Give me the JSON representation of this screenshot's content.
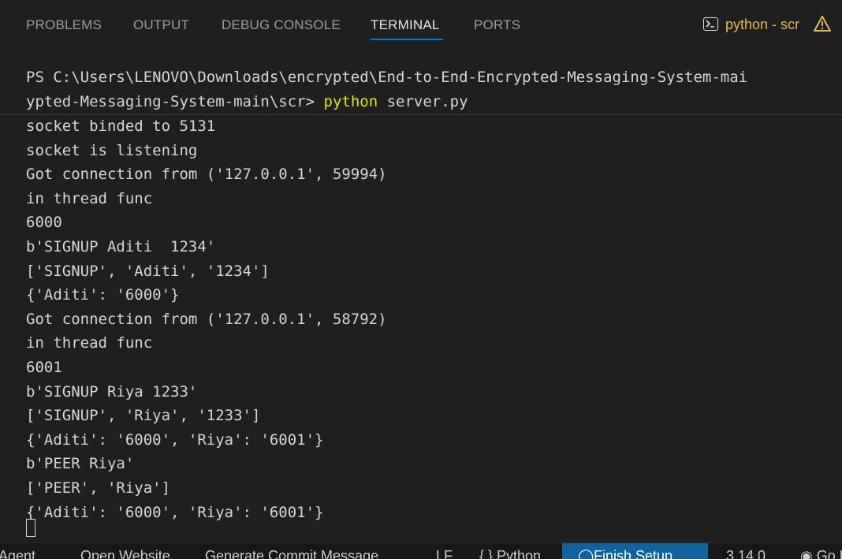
{
  "tabs": [
    {
      "label": "PROBLEMS",
      "active": false
    },
    {
      "label": "OUTPUT",
      "active": false
    },
    {
      "label": "DEBUG CONSOLE",
      "active": false
    },
    {
      "label": "TERMINAL",
      "active": true
    },
    {
      "label": "PORTS",
      "active": false
    }
  ],
  "terminal_indicator": {
    "label": "python - scr",
    "icon": "terminal-icon",
    "warning_icon": "warning-icon",
    "color": "#e5b94e"
  },
  "terminal": {
    "prompt_line1": "PS C:\\Users\\LENOVO\\Downloads\\encrypted\\End-to-End-Encrypted-Messaging-System-mai",
    "prompt_line2_prefix": "ypted-Messaging-System-main\\scr> ",
    "command": "python",
    "command_args": " server.py",
    "output": [
      "socket binded to 5131",
      "socket is listening",
      "Got connection from ('127.0.0.1', 59994)",
      "in thread func",
      "6000",
      "b'SIGNUP Aditi  1234'",
      "['SIGNUP', 'Aditi', '1234']",
      "{'Aditi': '6000'}",
      "Got connection from ('127.0.0.1', 58792)",
      "in thread func",
      "6001",
      "b'SIGNUP Riya 1233'",
      "['SIGNUP', 'Riya', '1233']",
      "{'Aditi': '6000', 'Riya': '6001'}",
      "b'PEER Riya'",
      "['PEER', 'Riya']",
      "{'Aditi': '6000', 'Riya': '6001'}"
    ]
  },
  "statusbar": {
    "items": [
      {
        "label": "Agent"
      },
      {
        "label": "Open Website"
      },
      {
        "label": "Generate Commit Message"
      },
      {
        "label": "LF"
      },
      {
        "label": "{ } Python"
      },
      {
        "label": "Finish Setup"
      },
      {
        "label": "3.14.0"
      },
      {
        "label": "Go Live"
      }
    ],
    "highlight_color": "#0e639c"
  }
}
